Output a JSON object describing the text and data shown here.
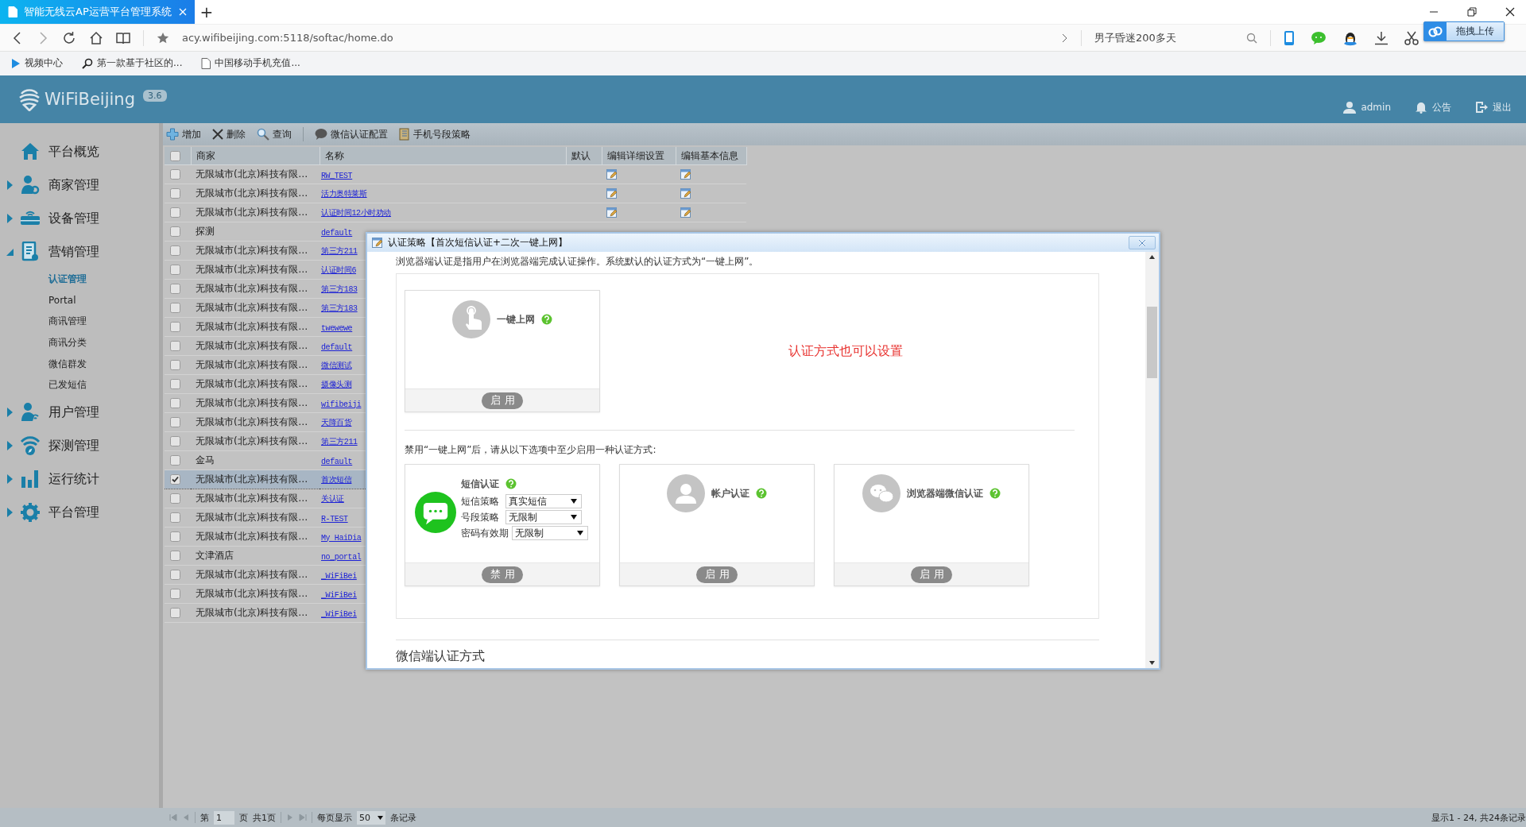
{
  "browser": {
    "tabs": [
      {
        "title": "智能无线云AP运营平台管理系统",
        "selected": true
      }
    ],
    "new_tab": "+",
    "address": "acy.wifibeijing.com:5118/softac/home.do",
    "search": {
      "value": "男子昏迷200多天"
    },
    "upload_button": "拖拽上传",
    "bookmarks": [
      "视频中心",
      "第一款基于社区的...",
      "中国移动手机充值..."
    ]
  },
  "header": {
    "logo": "WiFiBeijing",
    "version": "3.6",
    "user": "admin",
    "notice": "公告",
    "logout": "退出"
  },
  "sidebar": {
    "items": [
      {
        "label": "平台概览"
      },
      {
        "label": "商家管理",
        "expanded": false
      },
      {
        "label": "设备管理",
        "expanded": false
      },
      {
        "label": "营销管理",
        "expanded": true,
        "children": [
          {
            "label": "认证管理",
            "selected": true
          },
          {
            "label": "Portal",
            "selected": false
          },
          {
            "label": "商讯管理",
            "selected": false
          },
          {
            "label": "商讯分类",
            "selected": false
          },
          {
            "label": "微信群发",
            "selected": false
          },
          {
            "label": "已发短信",
            "selected": false
          }
        ]
      },
      {
        "label": "用户管理",
        "expanded": false
      },
      {
        "label": "探测管理",
        "expanded": false
      },
      {
        "label": "运行统计",
        "expanded": false
      },
      {
        "label": "平台管理",
        "expanded": false
      }
    ]
  },
  "toolbar": [
    "增加",
    "删除",
    "查询",
    "微信认证配置",
    "手机号段策略"
  ],
  "table": {
    "all_checked": false,
    "columns": [
      "商家",
      "名称",
      "默认",
      "编辑详细设置",
      "编辑基本信息"
    ],
    "rows": [
      {
        "merchant": "无限城市(北京)科技有限…",
        "name": "RW_TEST",
        "checked": false,
        "edit_icons": true
      },
      {
        "merchant": "无限城市(北京)科技有限…",
        "name": "活力奥特莱斯",
        "checked": false,
        "edit_icons": true
      },
      {
        "merchant": "无限城市(北京)科技有限…",
        "name": "认证时间12小时劝动",
        "checked": false,
        "edit_icons": true
      },
      {
        "merchant": "探测",
        "name": "default",
        "checked": false,
        "edit_icons": false
      },
      {
        "merchant": "无限城市(北京)科技有限…",
        "name": "第三方211",
        "checked": false,
        "edit_icons": false
      },
      {
        "merchant": "无限城市(北京)科技有限…",
        "name": "认证时间6",
        "checked": false,
        "edit_icons": false
      },
      {
        "merchant": "无限城市(北京)科技有限…",
        "name": "第三方183",
        "checked": false,
        "edit_icons": false
      },
      {
        "merchant": "无限城市(北京)科技有限…",
        "name": "第三方183",
        "checked": false,
        "edit_icons": false
      },
      {
        "merchant": "无限城市(北京)科技有限…",
        "name": "twewewe",
        "checked": false,
        "edit_icons": false
      },
      {
        "merchant": "无限城市(北京)科技有限…",
        "name": "default",
        "checked": false,
        "edit_icons": false
      },
      {
        "merchant": "无限城市(北京)科技有限…",
        "name": "微信测试",
        "checked": false,
        "edit_icons": false
      },
      {
        "merchant": "无限城市(北京)科技有限…",
        "name": "摄像头测",
        "checked": false,
        "edit_icons": false
      },
      {
        "merchant": "无限城市(北京)科技有限…",
        "name": "wifibeiji",
        "checked": false,
        "edit_icons": false
      },
      {
        "merchant": "无限城市(北京)科技有限…",
        "name": "天降百货",
        "checked": false,
        "edit_icons": false
      },
      {
        "merchant": "无限城市(北京)科技有限…",
        "name": "第三方211",
        "checked": false,
        "edit_icons": false
      },
      {
        "merchant": "金马",
        "name": "default",
        "checked": false,
        "edit_icons": false
      },
      {
        "merchant": "无限城市(北京)科技有限…",
        "name": "首次短信",
        "checked": true,
        "edit_icons": false
      },
      {
        "merchant": "无限城市(北京)科技有限…",
        "name": "关认证",
        "checked": false,
        "edit_icons": false
      },
      {
        "merchant": "无限城市(北京)科技有限…",
        "name": "R-TEST",
        "checked": false,
        "edit_icons": false
      },
      {
        "merchant": "无限城市(北京)科技有限…",
        "name": "My HaiDia",
        "checked": false,
        "edit_icons": false
      },
      {
        "merchant": "文津酒店",
        "name": "no_portal",
        "checked": false,
        "edit_icons": false
      },
      {
        "merchant": "无限城市(北京)科技有限…",
        "name": "_WiFiBei",
        "checked": false,
        "edit_icons": false
      },
      {
        "merchant": "无限城市(北京)科技有限…",
        "name": "_WiFiBei",
        "checked": false,
        "edit_icons": false
      },
      {
        "merchant": "无限城市(北京)科技有限…",
        "name": "_WiFiBei",
        "checked": false,
        "edit_icons": false
      }
    ]
  },
  "dialog": {
    "title": "认证策略【首次短信认证+二次一键上网】",
    "intro": "浏览器端认证是指用户在浏览器端完成认证操作。系统默认的认证方式为“一键上网”。",
    "methods": [
      {
        "kind": "one_click",
        "label": "一键上网",
        "enabled": false,
        "button": "启用"
      }
    ],
    "note": "认证方式也可以设置",
    "hint": "禁用“一键上网”后，请从以下选项中至少启用一种认证方式:",
    "options": [
      {
        "kind": "sms",
        "label": "短信认证",
        "enabled": true,
        "fields": [
          {
            "label": "短信策略",
            "value": "真实短信"
          },
          {
            "label": "号段策略",
            "value": "无限制"
          },
          {
            "label": "密码有效期",
            "value": "无限制"
          }
        ],
        "button": "禁用"
      },
      {
        "kind": "account",
        "label": "帐户认证",
        "enabled": false,
        "button": "启用"
      },
      {
        "kind": "wechat",
        "label": "浏览器端微信认证",
        "enabled": false,
        "button": "启用"
      }
    ],
    "next_section": "微信端认证方式"
  },
  "pager": {
    "page_prefix": "第",
    "page": "1",
    "page_suffix": "页",
    "total_pages": "共1页",
    "per_page_label": "每页显示",
    "per_page": "50",
    "per_page_suffix": "条记录",
    "summary": "显示1 - 24, 共24条记录"
  }
}
